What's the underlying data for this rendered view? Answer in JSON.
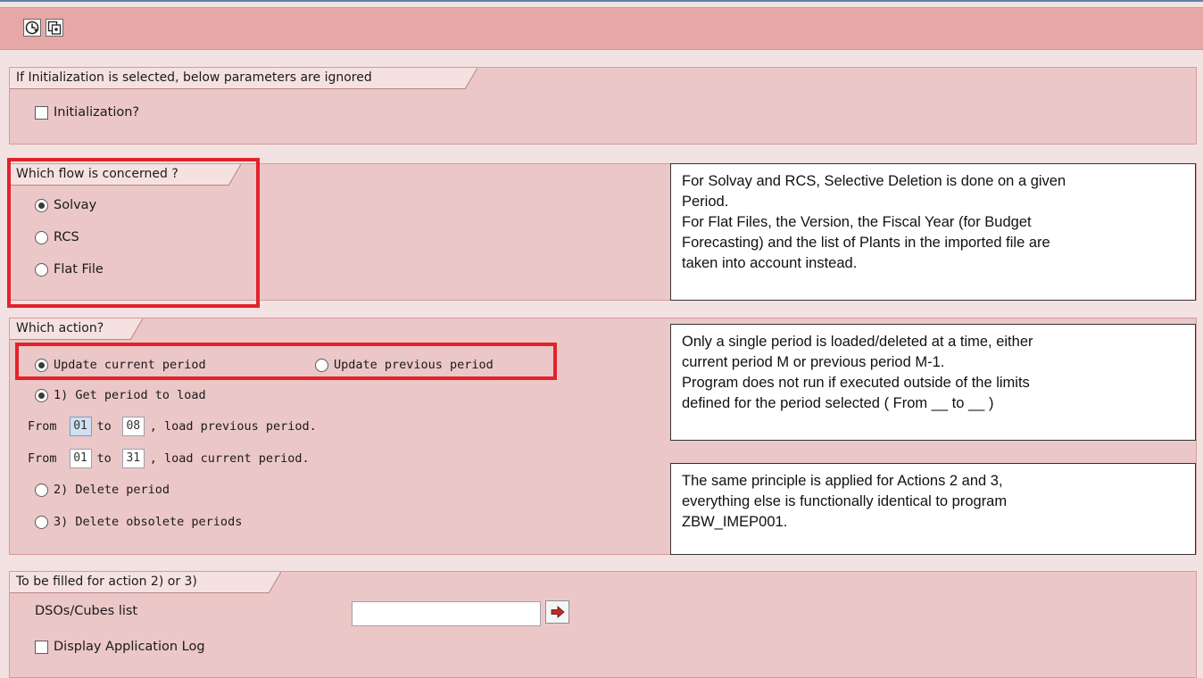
{
  "toolbar": {
    "execute_icon": "clock-execute-icon",
    "copy_icon": "copy-variant-icon"
  },
  "init_group": {
    "title": "If Initialization is selected, below parameters are ignored",
    "checkbox_label": "Initialization?",
    "checked": false
  },
  "flow_group": {
    "title": "Which flow is concerned ?",
    "options": [
      {
        "label": "Solvay",
        "selected": true
      },
      {
        "label": "RCS",
        "selected": false
      },
      {
        "label": "Flat File",
        "selected": false
      }
    ],
    "note": [
      "For Solvay and RCS, Selective Deletion is done on a given",
      "Period.",
      "For Flat Files, the Version, the Fiscal Year (for Budget",
      "Forecasting) and the list of Plants in the imported file are",
      "taken into account instead."
    ]
  },
  "action_group": {
    "title": "Which action?",
    "period_current": "Update current period",
    "period_previous": "Update previous period",
    "get_period": "1) Get period to load",
    "previous_row": {
      "from_label": "From",
      "from_value": "01",
      "to_label": "to",
      "to_value": "08",
      "suffix": ", load previous period."
    },
    "current_row": {
      "from_label": "From",
      "from_value": "01",
      "to_label": "to",
      "to_value": "31",
      "suffix": ", load current period."
    },
    "delete_period": "2) Delete period",
    "delete_obsolete": "3) Delete obsolete periods",
    "note1": [
      "Only a single period is loaded/deleted at a time, either",
      "current period M or previous period M-1.",
      "Program does not run if executed outside of the limits",
      "defined for the period selected ( From __ to __ )"
    ],
    "note2": [
      "The same principle is applied for Actions 2 and 3,",
      "everything else is functionally identical to program",
      "ZBW_IMEP001."
    ]
  },
  "fill_group": {
    "title": "To be filled for action 2) or 3)",
    "dso_label": "DSOs/Cubes list",
    "dso_value": "",
    "log_label": "Display Application Log",
    "log_checked": false
  },
  "colors": {
    "toolbar": "#e6a7a7",
    "group_bg": "#ecc7c7",
    "highlight": "#e2232b"
  }
}
